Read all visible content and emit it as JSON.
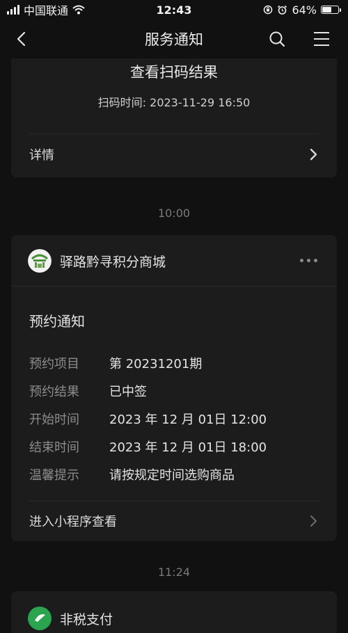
{
  "status_bar": {
    "carrier": "中国联通",
    "time": "12:43",
    "battery_percent": "64%",
    "battery_level": 0.64
  },
  "nav": {
    "title": "服务通知",
    "icons": [
      "back-arrow-icon",
      "search-icon",
      "menu-icon"
    ]
  },
  "card_scan": {
    "title": "查看扫码结果",
    "scan_time": "扫码时间: 2023-11-29 16:50",
    "details_label": "详情"
  },
  "separators": {
    "first": "10:00",
    "second": "11:24"
  },
  "card_reservation": {
    "brand_name": "驿路黔寻积分商城",
    "notice_title": "预约通知",
    "fields": [
      {
        "label": "预约项目",
        "value": "第 20231201期"
      },
      {
        "label": "预约结果",
        "value": "已中签"
      },
      {
        "label": "开始时间",
        "value": "2023 年 12 月 01日 12:00"
      },
      {
        "label": "结束时间",
        "value": "2023 年 12 月 01日 18:00"
      },
      {
        "label": "温馨提示",
        "value": "请按规定时间选购商品"
      }
    ],
    "action_label": "进入小程序查看"
  },
  "card_payment": {
    "name": "非税支付"
  },
  "colors": {
    "background": "#111111",
    "card": "#1c1c1c",
    "text_primary": "#e4e4e4",
    "text_secondary": "#8c8c8c",
    "payment_green": "#2aa44f"
  }
}
